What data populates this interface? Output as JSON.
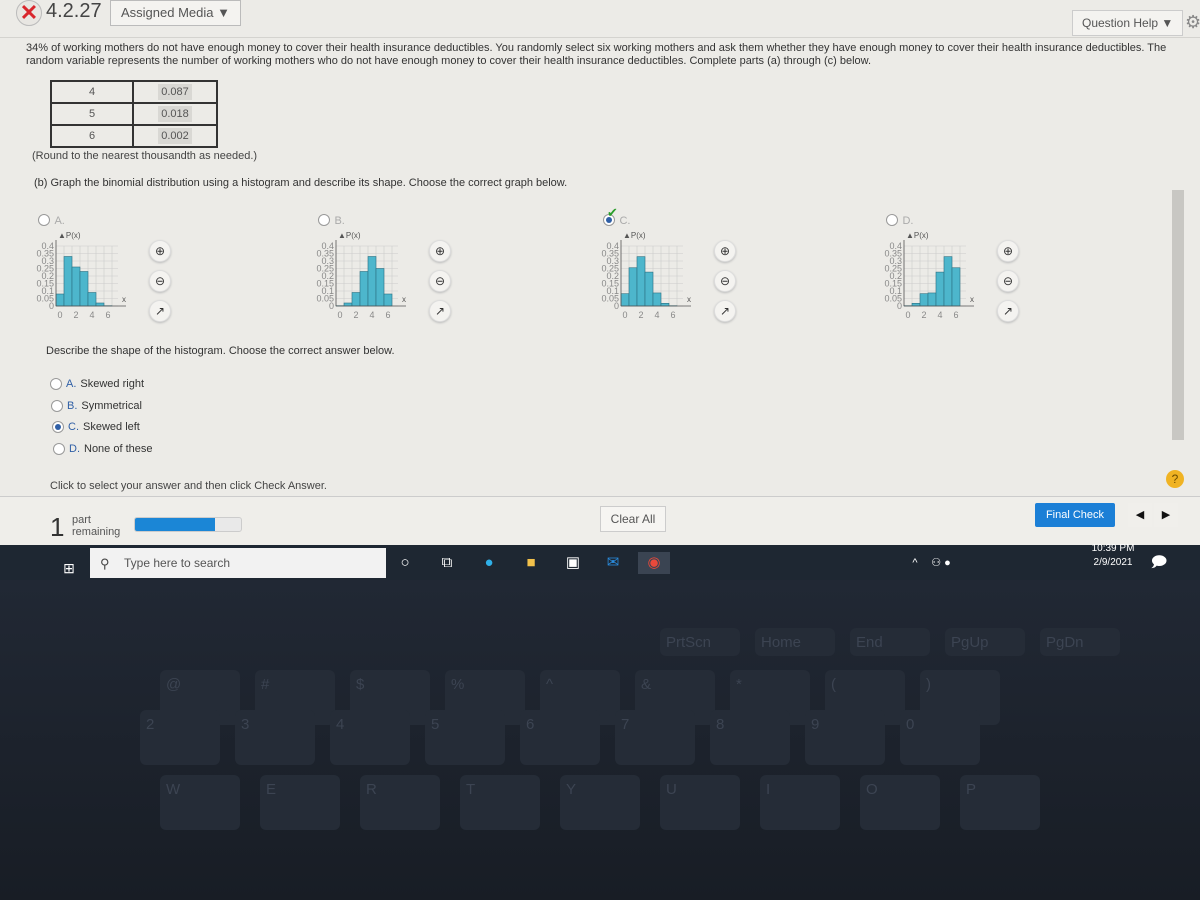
{
  "header": {
    "question_number": "4.2.27",
    "status_icon": "x-icon",
    "assigned_media": "Assigned Media ▼",
    "question_help": "Question Help ▼",
    "settings_icon": "gear-icon"
  },
  "stem": "34% of working mothers do not have enough money to cover their health insurance deductibles. You randomly select six working mothers and ask them whether they have enough money to cover their health insurance deductibles. The random variable represents the number of working mothers who do not have enough money to cover their health insurance deductibles. Complete parts (a) through (c) below.",
  "table": [
    {
      "x": "4",
      "p": "0.087"
    },
    {
      "x": "5",
      "p": "0.018"
    },
    {
      "x": "6",
      "p": "0.002"
    }
  ],
  "round_note": "(Round to the nearest thousandth as needed.)",
  "part_b": "(b) Graph the binomial distribution using a histogram and describe its shape. Choose the correct graph below.",
  "graphs": [
    {
      "label": "A.",
      "selected": false,
      "values": [
        0.08,
        0.33,
        0.26,
        0.23,
        0.09,
        0.02,
        0.002
      ]
    },
    {
      "label": "B.",
      "selected": false,
      "values": [
        0.002,
        0.02,
        0.09,
        0.23,
        0.33,
        0.25,
        0.08
      ]
    },
    {
      "label": "C.",
      "selected": true,
      "correct": true,
      "values": [
        0.082,
        0.255,
        0.329,
        0.226,
        0.087,
        0.018,
        0.002
      ]
    },
    {
      "label": "D.",
      "selected": false,
      "values": [
        0.002,
        0.018,
        0.082,
        0.087,
        0.226,
        0.329,
        0.255
      ]
    }
  ],
  "graph_axis": {
    "ylabel": "P(x)",
    "xlabel": "x",
    "yticks": [
      "0",
      "0.05",
      "0.1",
      "0.15",
      "0.2",
      "0.25",
      "0.3",
      "0.35",
      "0.4"
    ],
    "xticks": [
      "0",
      "2",
      "4",
      "6"
    ],
    "ylim": [
      0,
      0.4
    ],
    "bar_color": "#4db6cc"
  },
  "describe_prompt": "Describe the shape of the histogram. Choose the correct answer below.",
  "answers": [
    {
      "letter": "A.",
      "text": "Skewed right",
      "selected": false
    },
    {
      "letter": "B.",
      "text": "Symmetrical",
      "selected": false
    },
    {
      "letter": "C.",
      "text": "Skewed left",
      "selected": true
    },
    {
      "letter": "D.",
      "text": "None of these",
      "selected": false
    }
  ],
  "instruction": "Click to select your answer and then click Check Answer.",
  "footer": {
    "parts_count": "1",
    "parts_label_1": "part",
    "parts_label_2": "remaining",
    "progress_percent": 75,
    "clear_all": "Clear All",
    "final_check": "Final Check",
    "help": "?"
  },
  "taskbar": {
    "search_placeholder": "Type here to search",
    "time": "10:39 PM",
    "date": "2/9/2021"
  },
  "keyboard": [
    "PrtScn",
    "Home",
    "End",
    "PgUp",
    "PgDn",
    "@",
    "#",
    "$",
    "%",
    "^",
    "&",
    "*",
    "(",
    ")",
    "2",
    "3",
    "4",
    "5",
    "6",
    "7",
    "8",
    "9",
    "0",
    "W",
    "E",
    "R",
    "T",
    "Y",
    "U",
    "I",
    "O",
    "P"
  ]
}
